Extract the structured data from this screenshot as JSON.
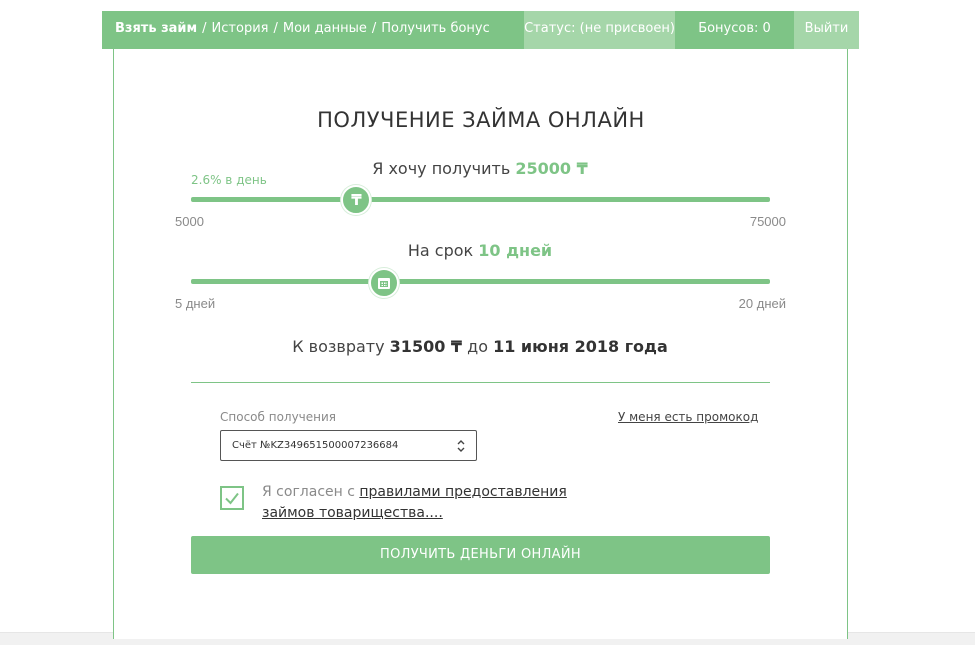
{
  "nav": {
    "items": [
      {
        "label": "Взять займ",
        "active": true
      },
      {
        "label": "История",
        "active": false
      },
      {
        "label": "Мои данные",
        "active": false
      },
      {
        "label": "Получить бонус",
        "active": false
      }
    ],
    "separator": "/",
    "status": "Статус: (не присвоен)",
    "bonuses": "Бонусов: 0",
    "logout": "Выйти"
  },
  "loan": {
    "title": "ПОЛУЧЕНИЕ ЗАЙМА ОНЛАЙН",
    "amount": {
      "prefix": "Я хочу получить",
      "value": "25000 ₸",
      "rate": "2.6% в день",
      "min": "5000",
      "max": "75000",
      "min_value": 5000,
      "max_value": 75000,
      "current_value": 25000,
      "knob_icon": "tenge-icon",
      "knob_glyph": "₸"
    },
    "term": {
      "prefix": "На срок",
      "value": "10 дней",
      "min": "5 дней",
      "max": "20 дней",
      "min_value": 5,
      "max_value": 20,
      "current_value": 10,
      "knob_icon": "calendar-icon"
    },
    "return": {
      "prefix": "К возврату",
      "amount": "31500 ₸",
      "middle": "до",
      "date": "11 июня 2018 года"
    }
  },
  "form": {
    "method_label": "Способ получения",
    "promo_link": "У меня есть промокод",
    "method_value": "Счёт №KZ349651500007236684",
    "agree_prefix": "Я согласен с",
    "agree_link": "правилами предоставления займов товарищества....",
    "agreed": true,
    "submit_label": "ПОЛУЧИТЬ ДЕНЬГИ ОНЛАЙН"
  },
  "colors": {
    "accent": "#7ec486",
    "accent_light": "#a5d6a9",
    "text": "#333333",
    "muted": "#8a8a8a"
  }
}
